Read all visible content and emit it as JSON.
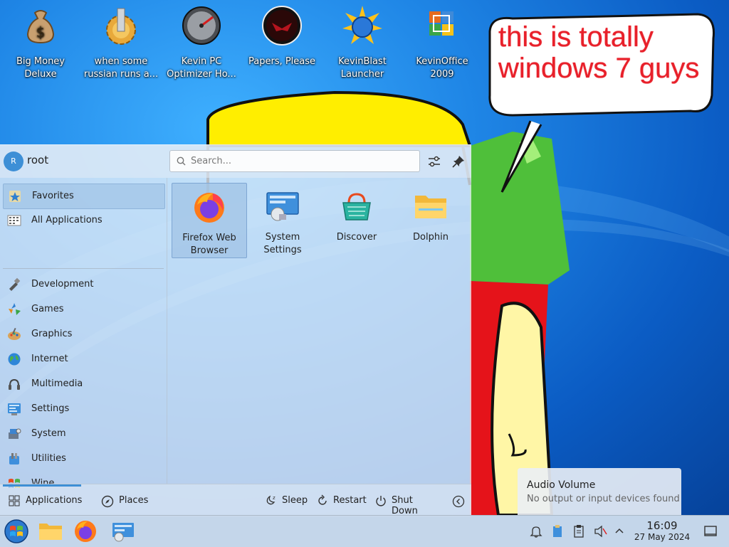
{
  "desktop_icons": [
    {
      "line1": "Big Money",
      "line2": "Deluxe",
      "icon": "money-bag-icon"
    },
    {
      "line1": "when some",
      "line2": "russian runs a...",
      "icon": "gear-icon"
    },
    {
      "line1": "Kevin PC",
      "line2": "Optimizer Ho...",
      "icon": "speedometer-icon"
    },
    {
      "line1": "Papers, Please",
      "line2": "",
      "icon": "eagle-seal-icon"
    },
    {
      "line1": "KevinBlast",
      "line2": "Launcher",
      "icon": "globe-burst-icon"
    },
    {
      "line1": "KevinOffice",
      "line2": "2009",
      "icon": "office-icon"
    }
  ],
  "bubble": {
    "line1": "this is totally",
    "line2": "windows 7 guys"
  },
  "menu": {
    "user": {
      "avatar_letter": "R",
      "name": "root"
    },
    "search": {
      "placeholder": "Search..."
    },
    "categories": [
      {
        "label": "Favorites",
        "icon": "star-icon",
        "selected": true
      },
      {
        "label": "All Applications",
        "icon": "grid-icon"
      },
      {
        "label": "Development",
        "icon": "development-icon"
      },
      {
        "label": "Games",
        "icon": "games-icon"
      },
      {
        "label": "Graphics",
        "icon": "graphics-icon"
      },
      {
        "label": "Internet",
        "icon": "internet-icon"
      },
      {
        "label": "Multimedia",
        "icon": "multimedia-icon"
      },
      {
        "label": "Settings",
        "icon": "settings-icon"
      },
      {
        "label": "System",
        "icon": "system-icon"
      },
      {
        "label": "Utilities",
        "icon": "utilities-icon"
      },
      {
        "label": "Wine",
        "icon": "wine-icon"
      }
    ],
    "favorites": [
      {
        "line1": "Firefox Web",
        "line2": "Browser",
        "icon": "firefox-icon",
        "selected": true
      },
      {
        "line1": "System",
        "line2": "Settings",
        "icon": "system-settings-icon"
      },
      {
        "line1": "Discover",
        "line2": "",
        "icon": "discover-icon"
      },
      {
        "line1": "Dolphin",
        "line2": "",
        "icon": "folder-icon"
      }
    ],
    "footer": {
      "applications": "Applications",
      "places": "Places",
      "sleep": "Sleep",
      "restart": "Restart",
      "shutdown": "Shut Down"
    }
  },
  "notification": {
    "title": "Audio Volume",
    "message": "No output or input devices found"
  },
  "taskbar": {
    "time": "16:09",
    "date": "27 May 2024"
  },
  "colors": {
    "accent": "#3d8fd6",
    "bubble_text": "#e8202a",
    "desktop_blue": "#1f86e6"
  }
}
